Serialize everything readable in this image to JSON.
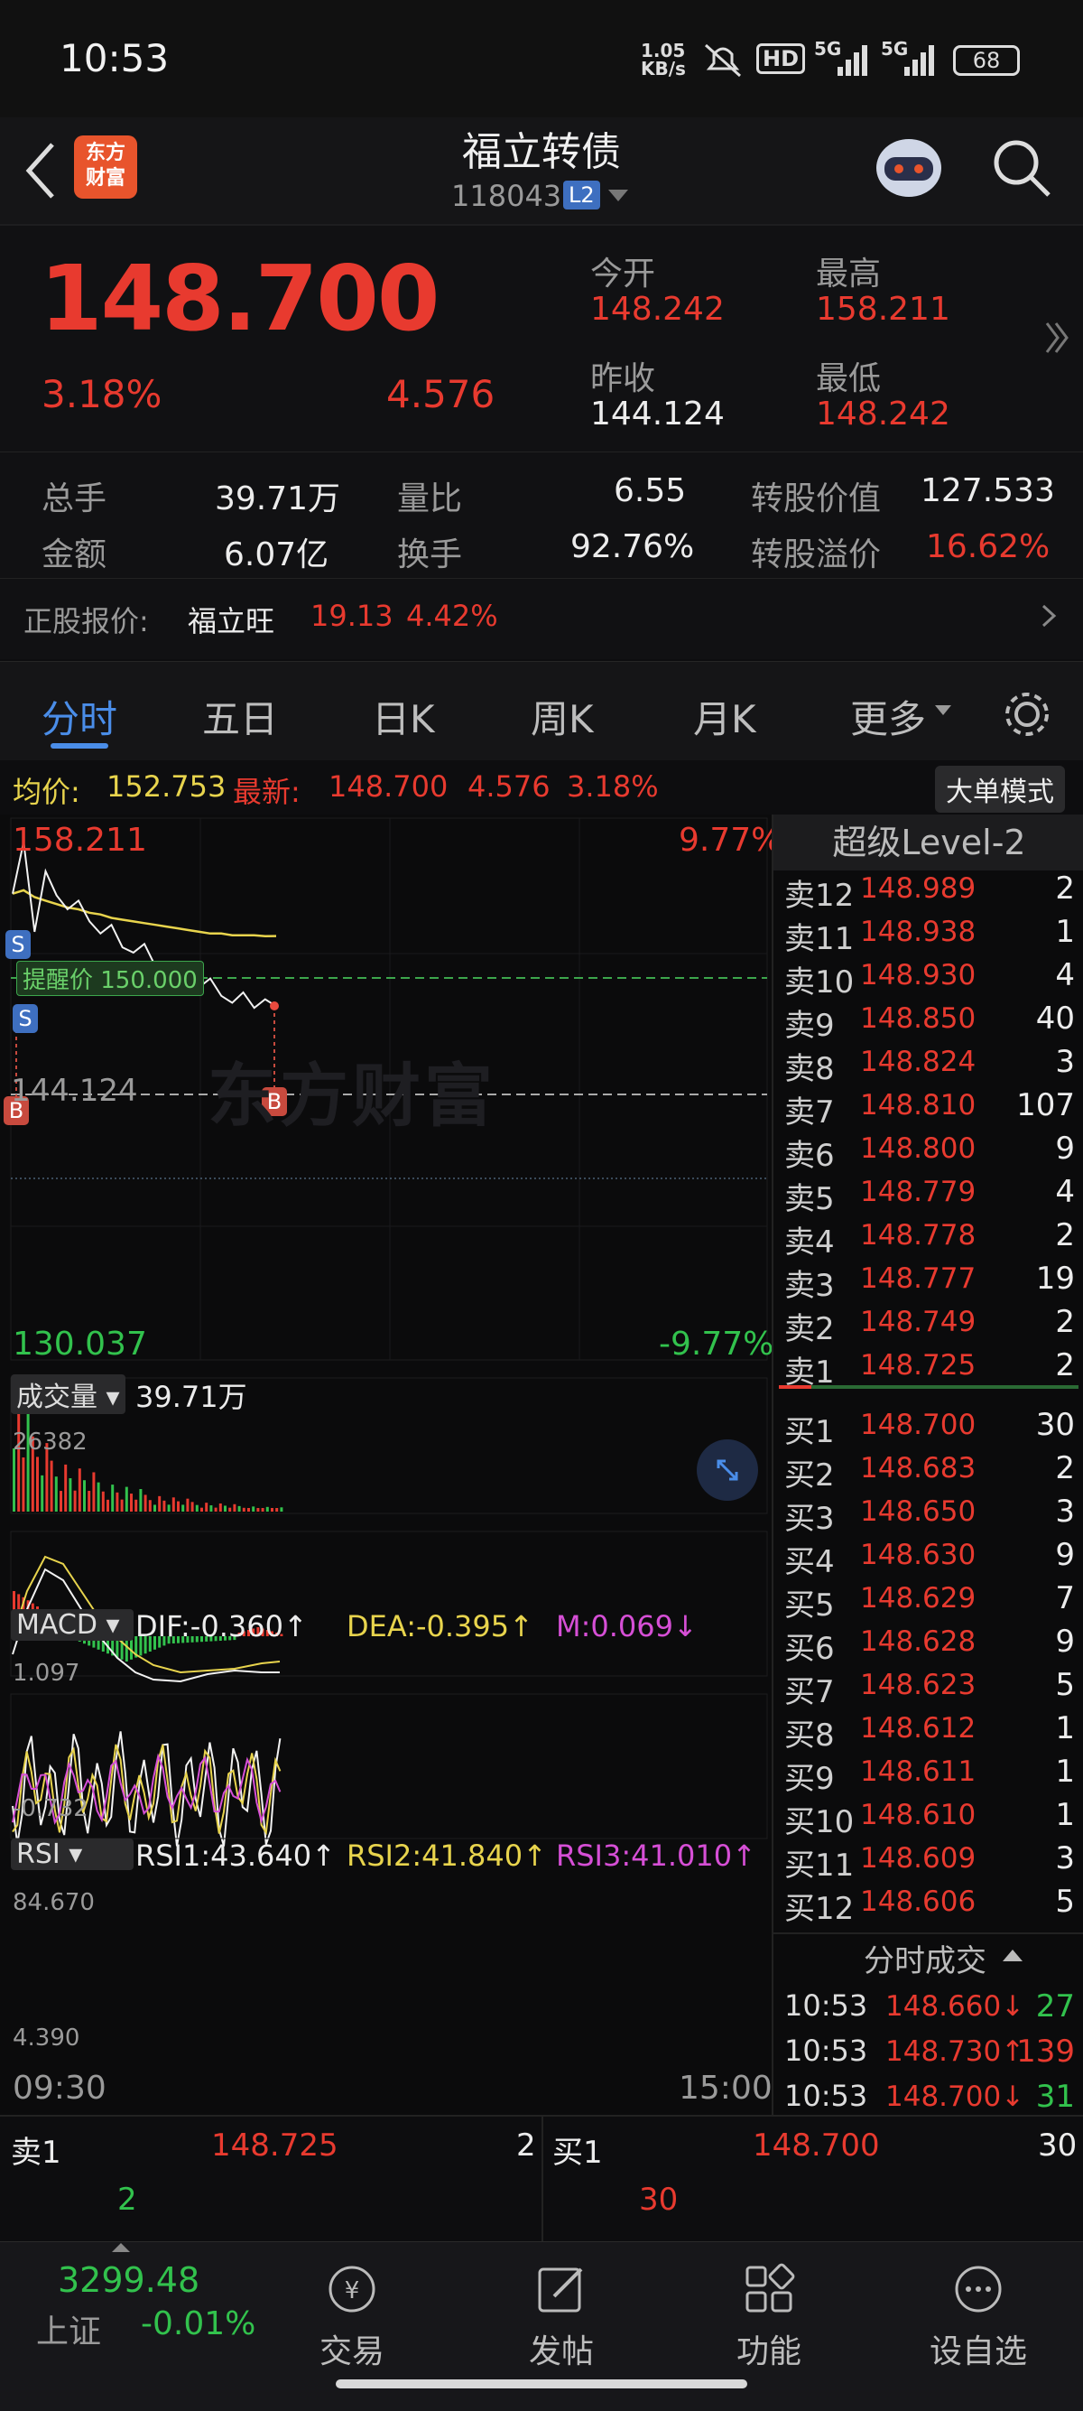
{
  "status": {
    "time": "10:53",
    "net_speed": "1.05\nKB/s",
    "hd": "HD",
    "sig1": "5G",
    "sig2": "5G",
    "battery": "68"
  },
  "header": {
    "logo": "东方\n财富",
    "title": "福立转债",
    "code": "118043",
    "level": "L2"
  },
  "quote": {
    "price": "148.700",
    "change_pct": "3.18%",
    "change_amt": "4.576",
    "open_label": "今开",
    "open": "148.242",
    "high_label": "最高",
    "high": "158.211",
    "prev_label": "昨收",
    "prev": "144.124",
    "low_label": "最低",
    "low": "148.242"
  },
  "stats": {
    "vol_label": "总手",
    "vol": "39.71万",
    "ratio_label": "量比",
    "ratio": "6.55",
    "conv_label": "转股价值",
    "conv": "127.533",
    "amt_label": "金额",
    "amt": "6.07亿",
    "turn_label": "换手",
    "turn": "92.76%",
    "prem_label": "转股溢价",
    "prem": "16.62%"
  },
  "stock": {
    "label": "正股报价:",
    "name": "福立旺",
    "price": "19.13",
    "pct": "4.42%"
  },
  "tabs": [
    "分时",
    "五日",
    "日K",
    "周K",
    "月K",
    "更多"
  ],
  "infobar": {
    "avg_label": "均价:",
    "avg": "152.753",
    "last_label": "最新:",
    "last": "148.700",
    "chg": "4.576",
    "pct": "3.18%",
    "mode_btn": "大单模式"
  },
  "chart": {
    "top_price": "158.211",
    "top_pct": "9.77%",
    "bottom_price": "130.037",
    "bottom_pct": "-9.77%",
    "prev_close": "144.124",
    "alert": "提醒价 150.000",
    "watermark": "东方财富",
    "vol_btn": "成交量",
    "vol_total": "39.71万",
    "vol_max": "26382",
    "macd_btn": "MACD",
    "dif": "DIF:-0.360↑",
    "dea": "DEA:-0.395↑",
    "m": "M:0.069↓",
    "macd_top": "1.097",
    "macd_bottom": "-0.732",
    "rsi_btn": "RSI",
    "rsi1": "RSI1:43.640↑",
    "rsi2": "RSI2:41.840↑",
    "rsi3": "RSI3:41.010↑",
    "rsi_top": "84.670",
    "rsi_bottom": "4.390",
    "time_start": "09:30",
    "time_end": "15:00"
  },
  "chart_data": {
    "type": "line",
    "x_range": [
      "09:30",
      "15:00"
    ],
    "ylim": [
      130.037,
      158.211
    ],
    "prev_close": 144.124,
    "price_series": [
      155.2,
      158.2,
      153.0,
      156.5,
      155.1,
      154.3,
      154.8,
      153.6,
      152.9,
      153.4,
      152.1,
      151.8,
      152.3,
      151.0,
      150.6,
      151.2,
      150.1,
      149.8,
      150.3,
      149.3,
      148.9,
      149.5,
      148.6,
      149.1,
      148.7
    ],
    "avg_series": [
      155.2,
      155.4,
      155.0,
      154.8,
      154.6,
      154.4,
      154.3,
      154.1,
      154.0,
      153.8,
      153.7,
      153.6,
      153.5,
      153.4,
      153.3,
      153.2,
      153.1,
      153.0,
      152.9,
      152.9,
      152.8,
      152.8,
      152.8,
      152.75,
      152.753
    ]
  },
  "book": {
    "title": "超级Level-2",
    "sells": [
      {
        "l": "卖12",
        "p": "148.989",
        "q": "2"
      },
      {
        "l": "卖11",
        "p": "148.938",
        "q": "1"
      },
      {
        "l": "卖10",
        "p": "148.930",
        "q": "4"
      },
      {
        "l": "卖9",
        "p": "148.850",
        "q": "40"
      },
      {
        "l": "卖8",
        "p": "148.824",
        "q": "3"
      },
      {
        "l": "卖7",
        "p": "148.810",
        "q": "107"
      },
      {
        "l": "卖6",
        "p": "148.800",
        "q": "9"
      },
      {
        "l": "卖5",
        "p": "148.779",
        "q": "4"
      },
      {
        "l": "卖4",
        "p": "148.778",
        "q": "2"
      },
      {
        "l": "卖3",
        "p": "148.777",
        "q": "19"
      },
      {
        "l": "卖2",
        "p": "148.749",
        "q": "2"
      },
      {
        "l": "卖1",
        "p": "148.725",
        "q": "2"
      }
    ],
    "buys": [
      {
        "l": "买1",
        "p": "148.700",
        "q": "30"
      },
      {
        "l": "买2",
        "p": "148.683",
        "q": "2"
      },
      {
        "l": "买3",
        "p": "148.650",
        "q": "3"
      },
      {
        "l": "买4",
        "p": "148.630",
        "q": "9"
      },
      {
        "l": "买5",
        "p": "148.629",
        "q": "7"
      },
      {
        "l": "买6",
        "p": "148.628",
        "q": "9"
      },
      {
        "l": "买7",
        "p": "148.623",
        "q": "5"
      },
      {
        "l": "买8",
        "p": "148.612",
        "q": "1"
      },
      {
        "l": "买9",
        "p": "148.611",
        "q": "1"
      },
      {
        "l": "买10",
        "p": "148.610",
        "q": "1"
      },
      {
        "l": "买11",
        "p": "148.609",
        "q": "3"
      },
      {
        "l": "买12",
        "p": "148.606",
        "q": "5"
      }
    ],
    "trades_title": "分时成交",
    "trades": [
      {
        "t": "10:53",
        "p": "148.660↓",
        "q": "27",
        "c": "green"
      },
      {
        "t": "10:53",
        "p": "148.730↑",
        "q": "139",
        "c": "red"
      },
      {
        "t": "10:53",
        "p": "148.700↓",
        "q": "31",
        "c": "green"
      }
    ]
  },
  "bottombook": {
    "sell_label": "卖1",
    "sell_price": "148.725",
    "sell_qty": "2",
    "sell_sub": "2",
    "buy_label": "买1",
    "buy_price": "148.700",
    "buy_qty": "30",
    "buy_sub": "30"
  },
  "nav": {
    "index_value": "3299.48",
    "index_name": "上证",
    "index_pct": "-0.01%",
    "items": [
      "交易",
      "发帖",
      "功能",
      "设自选"
    ]
  }
}
